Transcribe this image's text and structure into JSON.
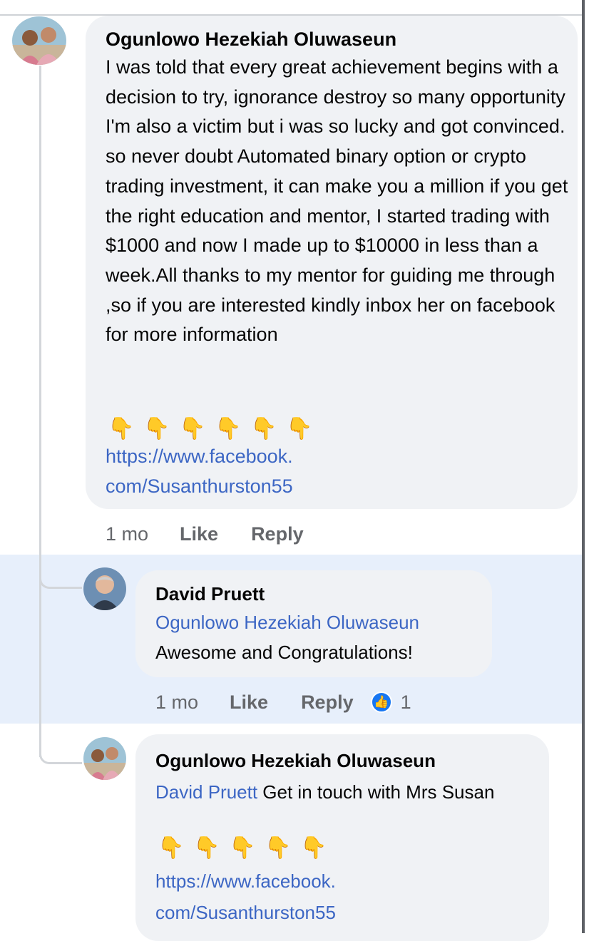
{
  "comments": [
    {
      "author": "Ogunlowo Hezekiah Oluwaseun",
      "body": "I was told that every great achievement begins with a decision to try, ignorance destroy so many opportunity I'm also a victim but i was so lucky and got convinced. so never doubt Automated binary option or crypto trading investment, it can make you a million if you get the right education and mentor, I started trading with $1000 and now I made up to $10000 in less than a week.All thanks to my mentor for guiding me through ,so if you are interested kindly inbox her on facebook for more information",
      "emoji": [
        "👇",
        "👇",
        "👇",
        "👇",
        "👇",
        "👇"
      ],
      "link_line1": "https://www.facebook.",
      "link_line2": "com/Susanthurston55",
      "time": "1 mo",
      "like_label": "Like",
      "reply_label": "Reply"
    },
    {
      "author": "David Pruett",
      "mention": "Ogunlowo Hezekiah Oluwaseun",
      "body": "Awesome and Congratulations!",
      "time": "1 mo",
      "like_label": "Like",
      "reply_label": "Reply",
      "reaction_count": "1",
      "reaction_icon": "thumbs-up-icon"
    },
    {
      "author": "Ogunlowo Hezekiah Oluwaseun",
      "mention": "David Pruett",
      "body_after_mention": " Get in touch with Mrs Susan",
      "emoji": [
        "👇",
        "👇",
        "👇",
        "👇",
        "👇"
      ],
      "link_line1": "https://www.facebook.",
      "link_line2": "com/Susanthurston55"
    }
  ],
  "colors": {
    "bubble": "#f0f2f5",
    "link": "#3c66c4",
    "meta": "#65676b",
    "highlight": "#e7effb",
    "like_badge": "#1877f2"
  }
}
